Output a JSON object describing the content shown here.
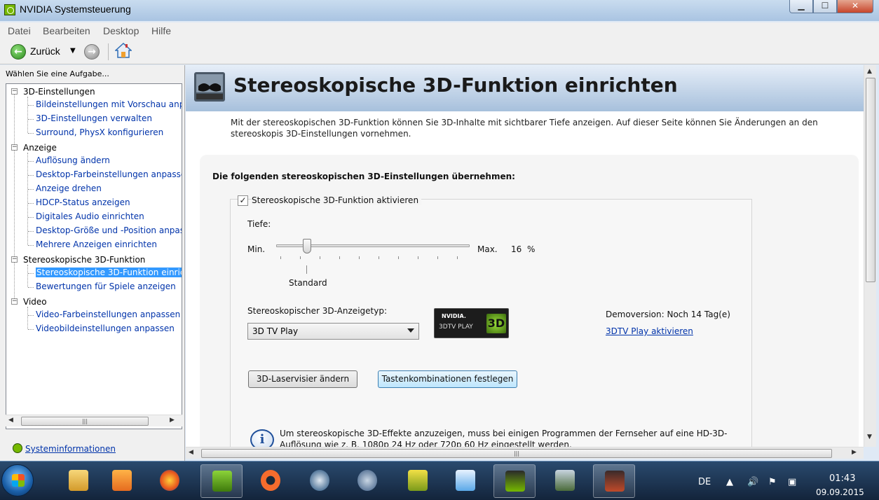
{
  "window": {
    "title": "NVIDIA Systemsteuerung"
  },
  "menus": [
    "Datei",
    "Bearbeiten",
    "Desktop",
    "Hilfe"
  ],
  "toolbar": {
    "back_label": "Zurück"
  },
  "left": {
    "task_label": "Wählen Sie eine Aufgabe...",
    "tree": [
      {
        "label": "3D-Einstellungen",
        "level": 0
      },
      {
        "label": "Bildeinstellungen mit Vorschau anpa",
        "level": 1
      },
      {
        "label": "3D-Einstellungen verwalten",
        "level": 1
      },
      {
        "label": "Surround, PhysX konfigurieren",
        "level": 1
      },
      {
        "label": "Anzeige",
        "level": 0
      },
      {
        "label": "Auflösung ändern",
        "level": 1
      },
      {
        "label": "Desktop-Farbeinstellungen anpasser",
        "level": 1
      },
      {
        "label": "Anzeige drehen",
        "level": 1
      },
      {
        "label": "HDCP-Status anzeigen",
        "level": 1
      },
      {
        "label": "Digitales Audio einrichten",
        "level": 1
      },
      {
        "label": "Desktop-Größe und -Position anpass",
        "level": 1
      },
      {
        "label": "Mehrere Anzeigen einrichten",
        "level": 1
      },
      {
        "label": "Stereoskopische 3D-Funktion",
        "level": 0
      },
      {
        "label": "Stereoskopische 3D-Funktion einrich",
        "level": 1,
        "selected": true
      },
      {
        "label": "Bewertungen für Spiele anzeigen",
        "level": 1
      },
      {
        "label": "Video",
        "level": 0
      },
      {
        "label": "Video-Farbeinstellungen anpassen",
        "level": 1
      },
      {
        "label": "Videobildeinstellungen anpassen",
        "level": 1
      }
    ],
    "sysinfo": "Systeminformationen"
  },
  "main": {
    "title": "Stereoskopische 3D-Funktion einrichten",
    "description": "Mit der stereoskopischen 3D-Funktion können Sie 3D-Inhalte mit sichtbarer Tiefe anzeigen. Auf dieser Seite können Sie Änderungen an den stereoskopis 3D-Einstellungen vornehmen.",
    "apply_heading": "Die folgenden stereoskopischen 3D-Einstellungen übernehmen:",
    "enable_label": "Stereoskopische 3D-Funktion aktivieren",
    "enable_checked": true,
    "depth_label": "Tiefe:",
    "min_label": "Min.",
    "max_label": "Max.",
    "depth_value": "16",
    "depth_unit": "%",
    "standard_label": "Standard",
    "type_label": "Stereoskopischer 3D-Anzeigetyp:",
    "type_value": "3D TV Play",
    "demo_text": "Demoversion: Noch 14 Tag(e)",
    "activate_link": "3DTV Play aktivieren",
    "laser_button": "3D-Laservisier ändern",
    "keys_button": "Tastenkombinationen festlegen",
    "info_text": "Um stereoskopische 3D-Effekte anzuzeigen, muss bei einigen Programmen der Fernseher auf eine HD-3D-Auflösung wie z. B. 1080p 24 Hz oder 720p 60 Hz eingestellt werden.",
    "logo_brand": "NVIDIA.",
    "logo_product": "3DTV PLAY",
    "logo_badge": "3D"
  },
  "taskbar": {
    "lang": "DE",
    "time": "01:43",
    "date": "09.09.2015"
  }
}
